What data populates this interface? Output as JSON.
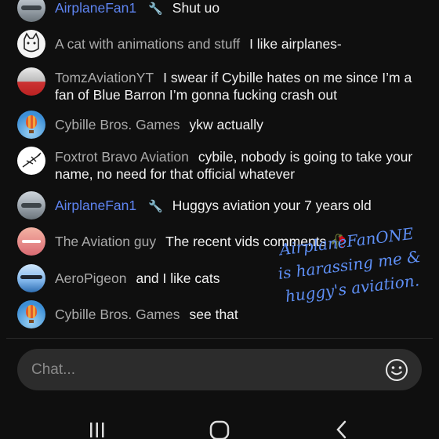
{
  "messages": [
    {
      "author": "AirplaneFan1",
      "is_moderator": true,
      "text": "Shut uo",
      "avatar": "airplane-avatar"
    },
    {
      "author": "A cat with animations and stuff",
      "is_moderator": false,
      "text": "I like airplanes-",
      "avatar": "cat-avatar"
    },
    {
      "author": "TomzAviationYT",
      "is_moderator": false,
      "text": "I swear if Cybille hates on me since I’m a fan of Blue Barron I’m gonna fucking crash out",
      "avatar": "red-plane-avatar"
    },
    {
      "author": "Cybille Bros. Games",
      "is_moderator": false,
      "text": "ykw actually",
      "avatar": "balloon-avatar"
    },
    {
      "author": "Foxtrot Bravo Aviation",
      "is_moderator": false,
      "text": "cybile, nobody is going to take your name, no need for that official whatever",
      "avatar": "sketch-plane-avatar"
    },
    {
      "author": "AirplaneFan1",
      "is_moderator": true,
      "text": "Huggys aviation your 7 years old",
      "avatar": "airplane-avatar"
    },
    {
      "author": "The Aviation guy",
      "is_moderator": false,
      "text": "The recent vids comments 🥀",
      "avatar": "sunset-plane-avatar"
    },
    {
      "author": "AeroPigeon",
      "is_moderator": false,
      "text": "and I like cats",
      "avatar": "sky-plane-avatar"
    },
    {
      "author": "Cybille Bros. Games",
      "is_moderator": false,
      "text": "see that",
      "avatar": "balloon-avatar"
    }
  ],
  "overlay": {
    "line1": "AirplaneFanONE",
    "line2": "is harassing me &",
    "line3": "huggy's aviation."
  },
  "chat_input": {
    "placeholder": "Chat...",
    "value": ""
  },
  "icons": {
    "emoji": "smiley-face-icon",
    "moderator": "wrench-icon"
  },
  "colors": {
    "background": "#0f0f0f",
    "moderator_name": "#5e84f1",
    "author_name": "#aaaaaa",
    "overlay_text": "#5e8ff5"
  }
}
